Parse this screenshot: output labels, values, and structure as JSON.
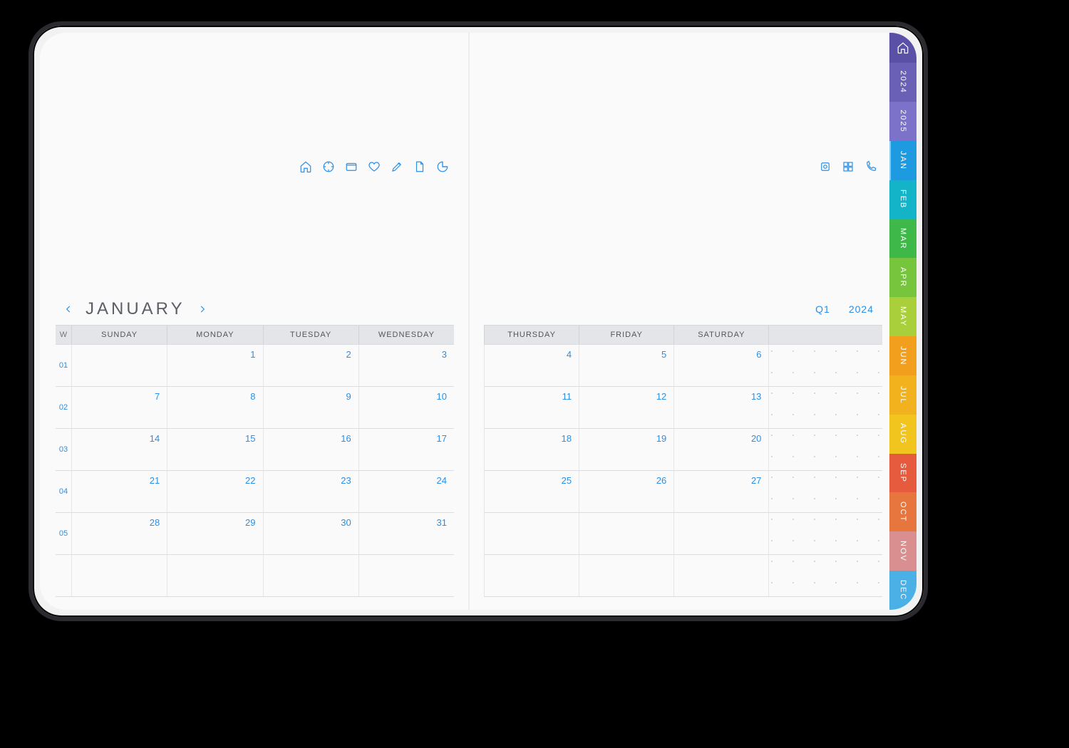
{
  "header": {
    "month": "JANUARY",
    "quarter": "Q1",
    "year": "2024",
    "icons_left": [
      "home",
      "target",
      "folder",
      "heart",
      "edit",
      "file",
      "chart"
    ],
    "icons_right": [
      "record",
      "dashboard",
      "phone"
    ]
  },
  "days_left": {
    "w": "W",
    "headers": [
      "SUNDAY",
      "MONDAY",
      "TUESDAY",
      "WEDNESDAY"
    ]
  },
  "days_right": {
    "headers": [
      "THURSDAY",
      "FRIDAY",
      "SATURDAY"
    ],
    "notes": ""
  },
  "weeks": [
    {
      "wk": "01",
      "left": [
        "",
        "1",
        "2",
        "3"
      ],
      "right": [
        "4",
        "5",
        "6"
      ]
    },
    {
      "wk": "02",
      "left": [
        "7",
        "8",
        "9",
        "10"
      ],
      "right": [
        "11",
        "12",
        "13"
      ]
    },
    {
      "wk": "03",
      "left": [
        "14",
        "15",
        "16",
        "17"
      ],
      "right": [
        "18",
        "19",
        "20"
      ]
    },
    {
      "wk": "04",
      "left": [
        "21",
        "22",
        "23",
        "24"
      ],
      "right": [
        "25",
        "26",
        "27"
      ]
    },
    {
      "wk": "05",
      "left": [
        "28",
        "29",
        "30",
        "31"
      ],
      "right": [
        "",
        "",
        ""
      ]
    },
    {
      "wk": "",
      "left": [
        "",
        "",
        "",
        ""
      ],
      "right": [
        "",
        "",
        ""
      ]
    }
  ],
  "tabs": [
    {
      "label": "2024",
      "color": "#6a60b5"
    },
    {
      "label": "2025",
      "color": "#7c72c9"
    },
    {
      "label": "JAN",
      "color": "#1e9ae1"
    },
    {
      "label": "FEB",
      "color": "#13b4c8"
    },
    {
      "label": "MAR",
      "color": "#3fb84a"
    },
    {
      "label": "APR",
      "color": "#76c53c"
    },
    {
      "label": "MAY",
      "color": "#a9cf3a"
    },
    {
      "label": "JUN",
      "color": "#f29f1e"
    },
    {
      "label": "JUL",
      "color": "#f2b21e"
    },
    {
      "label": "AUG",
      "color": "#f2c41e"
    },
    {
      "label": "SEP",
      "color": "#e65a3e"
    },
    {
      "label": "OCT",
      "color": "#e6753e"
    },
    {
      "label": "NOV",
      "color": "#d98f8f"
    },
    {
      "label": "DEC",
      "color": "#4ab0e6"
    }
  ],
  "home_tab_color": "#5a51a6"
}
